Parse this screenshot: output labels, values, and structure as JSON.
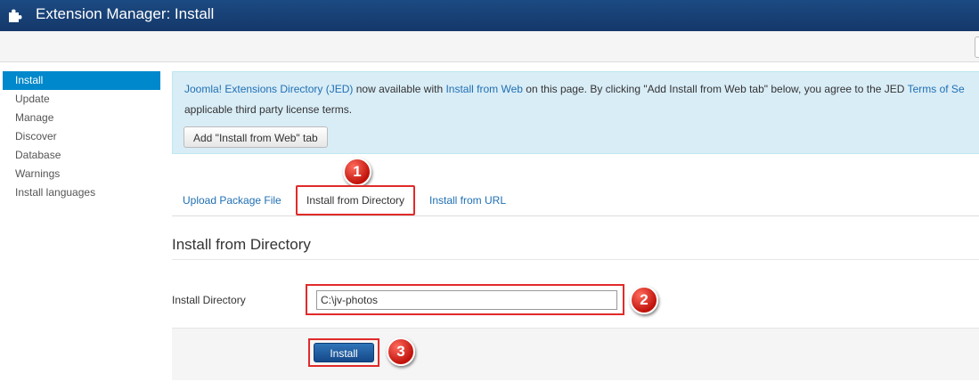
{
  "header": {
    "title": "Extension Manager: Install"
  },
  "sidebar": {
    "items": [
      {
        "label": "Install",
        "active": true
      },
      {
        "label": "Update"
      },
      {
        "label": "Manage"
      },
      {
        "label": "Discover"
      },
      {
        "label": "Database"
      },
      {
        "label": "Warnings"
      },
      {
        "label": "Install languages"
      }
    ]
  },
  "jed": {
    "link1": "Joomla! Extensions Directory (JED)",
    "text1": " now available with ",
    "link2": "Install from Web",
    "text2": " on this page.  By clicking \"Add Install from Web tab\" below, you agree to the JED ",
    "link3": "Terms of Se",
    "line2": "applicable third party license terms.",
    "button": "Add \"Install from Web\" tab"
  },
  "tabs": [
    {
      "label": "Upload Package File"
    },
    {
      "label": "Install from Directory",
      "active": true
    },
    {
      "label": "Install from URL"
    }
  ],
  "section": {
    "title": "Install from Directory"
  },
  "form": {
    "label": "Install Directory",
    "value": "C:\\jv-photos"
  },
  "actions": {
    "install_label": "Install"
  },
  "badges": [
    "1",
    "2",
    "3"
  ],
  "colors": {
    "header": "#1b4a82",
    "accent": "#0088cc",
    "highlight": "#e12a2a",
    "info_bg": "#d9edf7"
  }
}
